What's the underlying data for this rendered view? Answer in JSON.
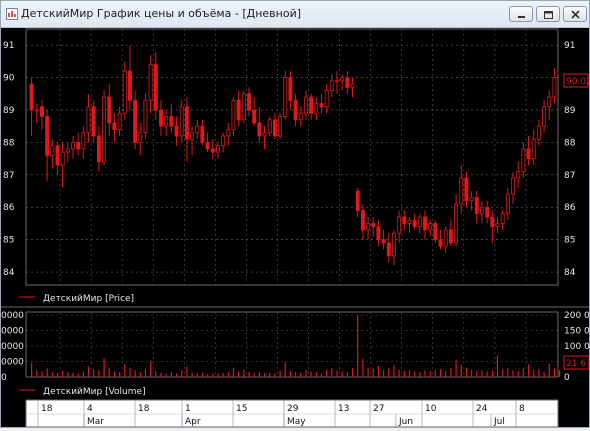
{
  "window": {
    "title": "ДетскийМир График цены и объёма - [Дневной]",
    "minimize_label": "minimize",
    "restore_label": "restore",
    "close_label": "close"
  },
  "colors": {
    "accent": "#e01818",
    "background": "#000000",
    "grid": "#5a5a5a",
    "text": "#e6e6e6",
    "price_tag": "#e01818"
  },
  "chart_data": [
    {
      "type": "candlestick",
      "legend": "ДетскийМир [Price]",
      "ylim": [
        83.6,
        91.5
      ],
      "yticks": [
        84,
        85,
        86,
        87,
        88,
        89,
        90,
        91
      ],
      "last_price": "90.02",
      "grid": true,
      "legend_placement": "bottom-left",
      "candles": [
        [
          89.8,
          90.0,
          88.2,
          89.0
        ],
        [
          89.0,
          89.2,
          88.6,
          89.0
        ],
        [
          89.1,
          89.3,
          88.4,
          88.8
        ],
        [
          88.8,
          89.0,
          86.8,
          87.6
        ],
        [
          87.6,
          88.1,
          87.2,
          87.9
        ],
        [
          87.9,
          88.0,
          87.0,
          87.3
        ],
        [
          87.3,
          88.0,
          86.6,
          87.7
        ],
        [
          87.7,
          88.0,
          87.4,
          87.8
        ],
        [
          87.8,
          88.2,
          87.5,
          88.0
        ],
        [
          88.0,
          88.3,
          87.6,
          87.8
        ],
        [
          87.8,
          88.5,
          87.5,
          88.3
        ],
        [
          88.3,
          89.5,
          88.0,
          89.1
        ],
        [
          89.1,
          89.3,
          88.0,
          88.2
        ],
        [
          88.2,
          88.5,
          87.1,
          87.4
        ],
        [
          87.4,
          89.6,
          87.3,
          89.4
        ],
        [
          89.4,
          89.8,
          88.2,
          88.6
        ],
        [
          88.6,
          88.9,
          88.0,
          88.4
        ],
        [
          88.4,
          89.1,
          88.2,
          88.9
        ],
        [
          88.9,
          90.5,
          88.7,
          90.2
        ],
        [
          90.2,
          91.0,
          89.0,
          89.3
        ],
        [
          89.3,
          89.6,
          87.8,
          88.0
        ],
        [
          88.0,
          88.6,
          87.6,
          88.3
        ],
        [
          88.3,
          89.5,
          88.1,
          89.3
        ],
        [
          89.3,
          90.7,
          88.9,
          90.4
        ],
        [
          90.4,
          90.8,
          88.7,
          89.0
        ],
        [
          89.0,
          89.3,
          88.2,
          88.5
        ],
        [
          88.5,
          89.0,
          88.2,
          88.8
        ],
        [
          88.8,
          89.2,
          88.3,
          88.5
        ],
        [
          88.5,
          88.8,
          87.9,
          88.2
        ],
        [
          88.2,
          89.3,
          88.0,
          89.1
        ],
        [
          89.1,
          89.4,
          87.4,
          88.1
        ],
        [
          88.1,
          88.5,
          87.6,
          88.3
        ],
        [
          88.3,
          88.7,
          88.1,
          88.5
        ],
        [
          88.5,
          88.7,
          87.9,
          88.0
        ],
        [
          88.0,
          88.3,
          87.7,
          87.8
        ],
        [
          87.8,
          88.1,
          87.5,
          87.7
        ],
        [
          87.7,
          88.0,
          87.5,
          87.9
        ],
        [
          87.9,
          88.3,
          87.7,
          88.2
        ],
        [
          88.2,
          88.6,
          87.9,
          88.4
        ],
        [
          88.4,
          89.4,
          88.2,
          89.3
        ],
        [
          89.3,
          89.6,
          88.5,
          88.7
        ],
        [
          88.7,
          89.6,
          88.6,
          89.5
        ],
        [
          89.5,
          89.7,
          88.8,
          89.0
        ],
        [
          89.0,
          89.4,
          88.5,
          88.6
        ],
        [
          88.6,
          89.1,
          88.0,
          88.2
        ],
        [
          88.2,
          88.5,
          87.8,
          88.3
        ],
        [
          88.3,
          88.8,
          88.2,
          88.7
        ],
        [
          88.7,
          88.9,
          88.1,
          88.2
        ],
        [
          88.2,
          88.9,
          88.1,
          88.8
        ],
        [
          88.8,
          90.2,
          88.7,
          90.0
        ],
        [
          90.0,
          90.2,
          89.0,
          89.3
        ],
        [
          89.3,
          89.5,
          88.5,
          88.7
        ],
        [
          88.7,
          89.1,
          88.5,
          88.9
        ],
        [
          88.9,
          89.6,
          88.7,
          89.4
        ],
        [
          89.4,
          89.5,
          88.7,
          88.9
        ],
        [
          88.9,
          89.4,
          88.7,
          89.2
        ],
        [
          89.2,
          89.5,
          88.9,
          89.1
        ],
        [
          89.1,
          89.8,
          88.9,
          89.6
        ],
        [
          89.6,
          90.1,
          89.4,
          89.9
        ],
        [
          89.9,
          90.2,
          89.5,
          89.9
        ],
        [
          89.9,
          90.1,
          89.6,
          90.0
        ],
        [
          90.0,
          90.2,
          89.5,
          89.7
        ],
        [
          89.7,
          90.0,
          89.4,
          89.8
        ],
        [
          86.5,
          86.6,
          85.7,
          85.9
        ],
        [
          85.9,
          86.1,
          85.0,
          85.3
        ],
        [
          85.3,
          85.7,
          85.0,
          85.5
        ],
        [
          85.5,
          85.7,
          85.1,
          85.4
        ],
        [
          85.4,
          85.6,
          84.8,
          85.0
        ],
        [
          85.0,
          85.3,
          84.7,
          84.9
        ],
        [
          84.9,
          85.2,
          84.3,
          84.5
        ],
        [
          84.5,
          85.3,
          84.2,
          85.2
        ],
        [
          85.2,
          85.9,
          84.9,
          85.7
        ],
        [
          85.7,
          85.9,
          85.3,
          85.5
        ],
        [
          85.5,
          85.7,
          85.2,
          85.6
        ],
        [
          85.6,
          85.8,
          85.3,
          85.4
        ],
        [
          85.4,
          85.8,
          85.2,
          85.7
        ],
        [
          85.7,
          85.9,
          85.0,
          85.3
        ],
        [
          85.3,
          85.6,
          85.1,
          85.5
        ],
        [
          85.5,
          85.6,
          84.9,
          85.0
        ],
        [
          85.0,
          85.3,
          84.7,
          84.8
        ],
        [
          84.8,
          85.4,
          84.6,
          85.3
        ],
        [
          85.3,
          85.6,
          84.8,
          84.9
        ],
        [
          84.9,
          86.4,
          84.8,
          86.1
        ],
        [
          86.1,
          87.3,
          85.8,
          86.9
        ],
        [
          86.9,
          87.1,
          86.0,
          86.2
        ],
        [
          86.2,
          86.5,
          85.9,
          86.3
        ],
        [
          86.3,
          86.5,
          85.5,
          85.8
        ],
        [
          85.8,
          86.2,
          85.5,
          86.0
        ],
        [
          86.0,
          86.2,
          85.5,
          85.7
        ],
        [
          85.7,
          85.9,
          84.9,
          85.4
        ],
        [
          85.4,
          85.7,
          85.2,
          85.5
        ],
        [
          85.5,
          85.9,
          85.3,
          85.8
        ],
        [
          85.8,
          86.6,
          85.6,
          86.4
        ],
        [
          86.4,
          87.1,
          86.1,
          86.9
        ],
        [
          86.9,
          87.4,
          86.6,
          87.1
        ],
        [
          87.1,
          88.0,
          86.9,
          87.8
        ],
        [
          87.8,
          88.2,
          87.3,
          87.5
        ],
        [
          87.5,
          88.4,
          87.3,
          88.1
        ],
        [
          88.1,
          88.7,
          87.9,
          88.5
        ],
        [
          88.5,
          89.3,
          88.3,
          89.1
        ],
        [
          89.1,
          89.6,
          88.7,
          89.4
        ],
        [
          89.4,
          90.3,
          89.2,
          90.0
        ]
      ]
    },
    {
      "type": "bar",
      "legend": "ДетскийМир [Volume]",
      "yticks_left": [
        "0000",
        "0000",
        "0000",
        "0000",
        "0"
      ],
      "yticks_right": [
        "200 0",
        "150 0",
        "100 0",
        "50 0",
        "0"
      ],
      "ylim": [
        0,
        200
      ],
      "last_value": "21 6",
      "grid": true,
      "legend_placement": "bottom-left",
      "values": [
        45,
        22,
        18,
        28,
        15,
        12,
        20,
        16,
        14,
        12,
        18,
        35,
        25,
        22,
        60,
        30,
        18,
        16,
        42,
        30,
        22,
        16,
        24,
        50,
        18,
        14,
        12,
        16,
        12,
        22,
        35,
        14,
        12,
        14,
        10,
        12,
        11,
        13,
        16,
        30,
        18,
        24,
        16,
        14,
        16,
        12,
        14,
        12,
        20,
        48,
        20,
        16,
        14,
        22,
        18,
        16,
        12,
        24,
        28,
        20,
        18,
        16,
        28,
        200,
        60,
        30,
        28,
        35,
        22,
        30,
        38,
        24,
        20,
        22,
        18,
        16,
        20,
        18,
        22,
        24,
        20,
        28,
        55,
        40,
        30,
        24,
        20,
        22,
        18,
        20,
        70,
        24,
        28,
        22,
        20,
        30,
        40,
        24,
        26,
        18,
        44,
        28,
        22
      ]
    }
  ],
  "xaxis": {
    "day_labels": [
      "18",
      "4",
      "18",
      "1",
      "15",
      "29",
      "13",
      "27",
      "10",
      "24",
      "8"
    ],
    "month_labels": [
      "Mar",
      "Apr",
      "May",
      "Jun",
      "Jul"
    ]
  }
}
